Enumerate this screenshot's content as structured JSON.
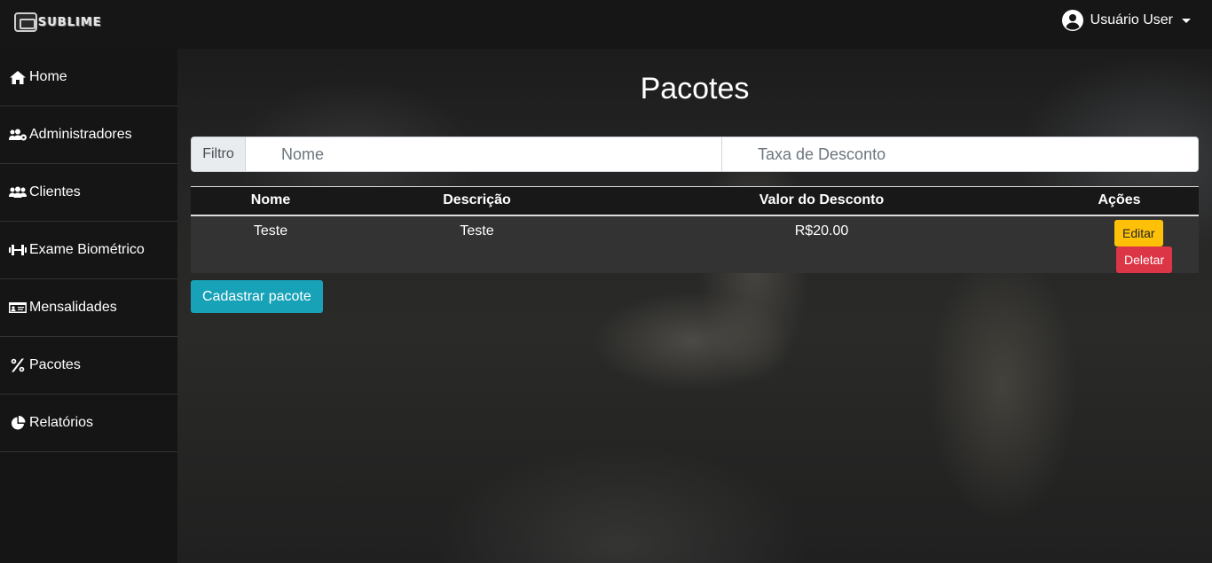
{
  "brand": {
    "name": "SUBLIME"
  },
  "user": {
    "name": "Usuário User"
  },
  "sidebar": {
    "items": [
      {
        "label": "Home",
        "icon": "home-icon"
      },
      {
        "label": "Administradores",
        "icon": "users-cog-icon"
      },
      {
        "label": "Clientes",
        "icon": "users-icon"
      },
      {
        "label": "Exame Biométrico",
        "icon": "dumbbell-icon"
      },
      {
        "label": "Mensalidades",
        "icon": "id-card-icon"
      },
      {
        "label": "Pacotes",
        "icon": "percent-icon"
      },
      {
        "label": "Relatórios",
        "icon": "pie-chart-icon"
      }
    ]
  },
  "main": {
    "title": "Pacotes",
    "filter": {
      "label": "Filtro",
      "name_placeholder": "Nome",
      "discount_placeholder": "Taxa de Desconto"
    },
    "table": {
      "columns": [
        "Nome",
        "Descrição",
        "Valor do Desconto",
        "Ações"
      ],
      "rows": [
        {
          "nome": "Teste",
          "descricao": "Teste",
          "valor": "R$20.00",
          "edit_label": "Editar",
          "delete_label": "Deletar"
        }
      ]
    },
    "create_button": "Cadastrar pacote"
  },
  "colors": {
    "edit": "#ffc107",
    "delete": "#dc3545",
    "primary": "#17a2b8",
    "sidebar": "#151515"
  }
}
